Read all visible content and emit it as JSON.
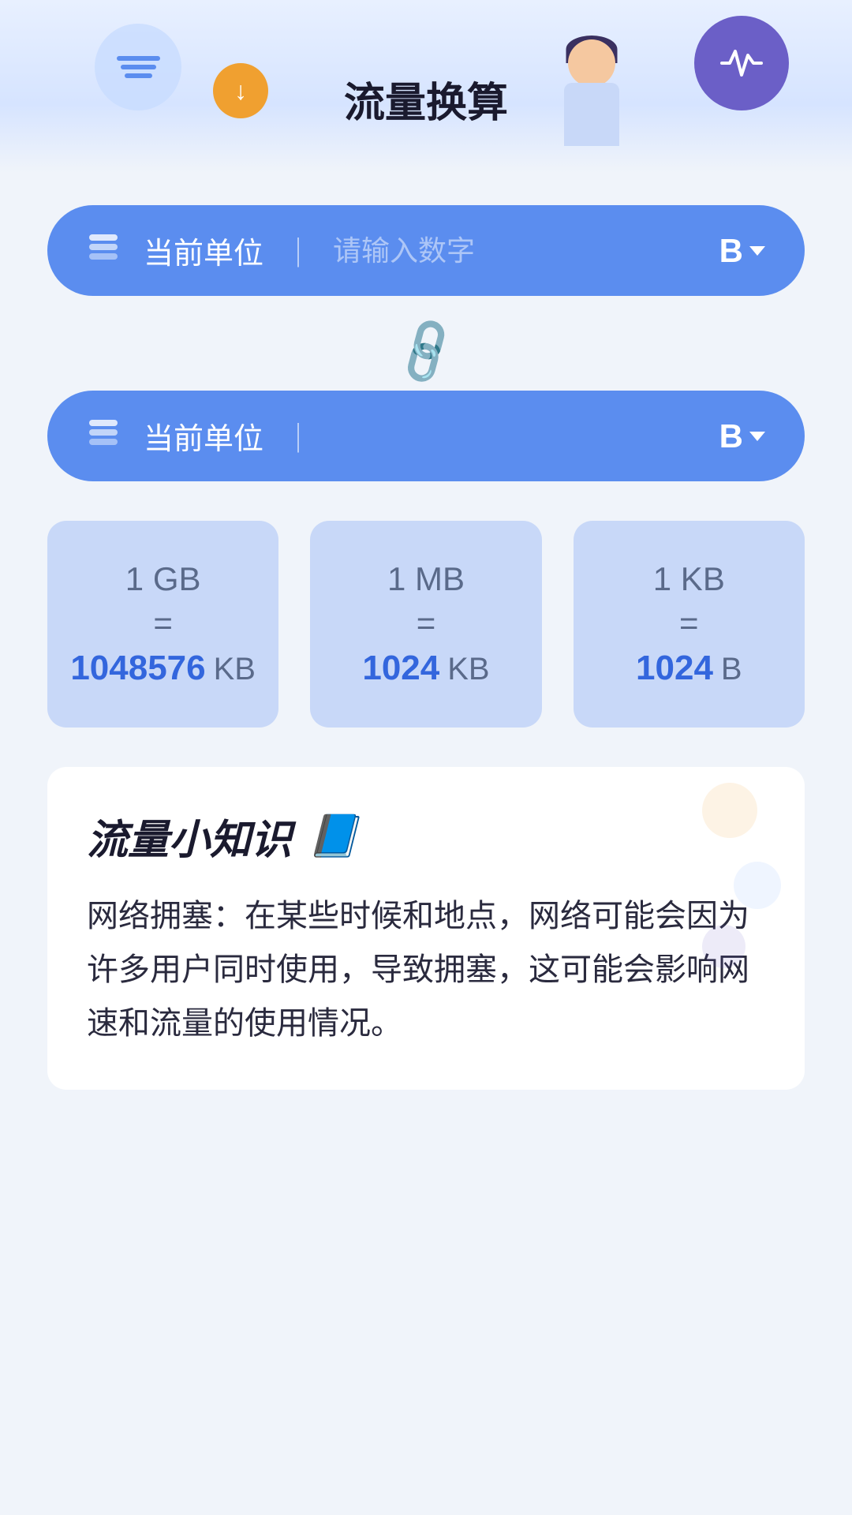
{
  "header": {
    "title": "流量换算",
    "left_icon": "wave-icon",
    "right_icon": "pulse-icon",
    "person": "person-illustration"
  },
  "input1": {
    "label": "当前单位",
    "placeholder": "请输入数字",
    "unit": "B",
    "icon": "layers-icon"
  },
  "input2": {
    "label": "当前单位",
    "placeholder": "",
    "unit": "B",
    "icon": "layers-icon"
  },
  "link_icon": "🔗",
  "conversions": [
    {
      "from": "1 GB",
      "equals": "=",
      "to_value": "1048576",
      "to_unit": "KB"
    },
    {
      "from": "1 MB",
      "equals": "=",
      "to_value": "1024",
      "to_unit": "KB"
    },
    {
      "from": "1 KB",
      "equals": "=",
      "to_value": "1024",
      "to_unit": "B"
    }
  ],
  "knowledge": {
    "title": "流量小知识",
    "title_icon": "📘",
    "content": "网络拥塞：在某些时候和地点，网络可能会因为许多用户同时使用，导致拥塞，这可能会影响网速和流量的使用情况。"
  }
}
